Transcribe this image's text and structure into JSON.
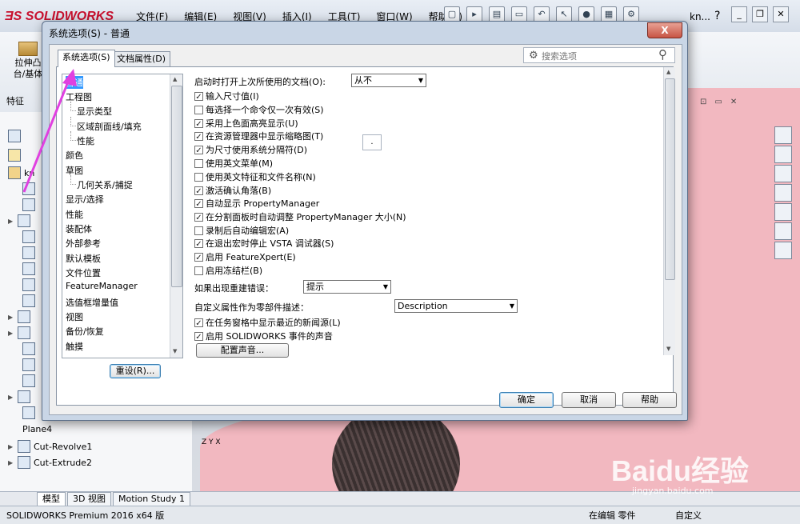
{
  "app": {
    "menu": [
      "文件(F)",
      "编辑(E)",
      "视图(V)",
      "插入(I)",
      "工具(T)",
      "窗口(W)",
      "帮助(H)"
    ],
    "user": "kn...",
    "help": "?",
    "cmd_extrude": "拉伸凸台/基体",
    "cmd_tab": "特征",
    "tree_root": "kn",
    "tree_items": [
      "Plane4",
      "Cut-Revolve1",
      "Cut-Extrude2"
    ],
    "bottom_tabs": [
      "模型",
      "3D 视图",
      "Motion Study 1"
    ],
    "status_left": "SOLIDWORKS Premium 2016 x64 版",
    "status_edit": "在编辑 零件",
    "status_custom": "自定义",
    "watermark": "Baidu经验",
    "watermark_url": "jingyan.baidu.com",
    "triad": "Z Y X",
    "brand_color": "#c8102e",
    "model_color": "#f2b8c0"
  },
  "dialog": {
    "title": "系统选项(S) - 普通",
    "close": "X",
    "tabs": [
      "系统选项(S)",
      "文档属性(D)"
    ],
    "search_placeholder": "搜索选项",
    "categories": [
      {
        "label": "普通",
        "sub": false,
        "selected": true
      },
      {
        "label": "工程图",
        "sub": false
      },
      {
        "label": "显示类型",
        "sub": true
      },
      {
        "label": "区域剖面线/填充",
        "sub": true
      },
      {
        "label": "性能",
        "sub": true
      },
      {
        "label": "颜色",
        "sub": false
      },
      {
        "label": "草图",
        "sub": false
      },
      {
        "label": "几何关系/捕捉",
        "sub": true
      },
      {
        "label": "显示/选择",
        "sub": false
      },
      {
        "label": "性能",
        "sub": false
      },
      {
        "label": "装配体",
        "sub": false
      },
      {
        "label": "外部参考",
        "sub": false
      },
      {
        "label": "默认模板",
        "sub": false
      },
      {
        "label": "文件位置",
        "sub": false
      },
      {
        "label": "FeatureManager",
        "sub": false
      },
      {
        "label": "选值框增量值",
        "sub": false
      },
      {
        "label": "视图",
        "sub": false
      },
      {
        "label": "备份/恢复",
        "sub": false
      },
      {
        "label": "触摸",
        "sub": false
      }
    ],
    "reset": "重设(R)...",
    "startup_label": "启动时打开上次所使用的文档(O):",
    "startup_value": "从不",
    "checkboxes": [
      {
        "label": "输入尺寸值(I)",
        "checked": true
      },
      {
        "label": "每选择一个命令仅一次有效(S)",
        "checked": false
      },
      {
        "label": "采用上色面高亮显示(U)",
        "checked": true
      },
      {
        "label": "在资源管理器中显示缩略图(T)",
        "checked": true
      },
      {
        "label": "为尺寸使用系统分隔符(D)",
        "checked": true
      },
      {
        "label": "使用英文菜单(M)",
        "checked": false
      },
      {
        "label": "使用英文特征和文件名称(N)",
        "checked": false
      },
      {
        "label": "激活确认角落(B)",
        "checked": true
      },
      {
        "label": "自动显示 PropertyManager",
        "checked": true
      },
      {
        "label": "在分割面板时自动调整 PropertyManager 大小(N)",
        "checked": true
      },
      {
        "label": "录制后自动编辑宏(A)",
        "checked": false
      },
      {
        "label": "在退出宏时停止 VSTA 调试器(S)",
        "checked": true
      },
      {
        "label": "启用 FeatureXpert(E)",
        "checked": true
      },
      {
        "label": "启用冻结栏(B)",
        "checked": false
      }
    ],
    "separator_value": ".",
    "rebuild_label": "如果出现重建错误：",
    "rebuild_value": "提示",
    "custom_prop_label": "自定义属性作为零部件描述：",
    "custom_prop_value": "Description",
    "checkboxes2": [
      {
        "label": "在任务窗格中显示最近的新闻源(L)",
        "checked": true
      },
      {
        "label": "启用 SOLIDWORKS 事件的声音",
        "checked": true
      }
    ],
    "config_sound": "配置声音...",
    "ok": "确定",
    "cancel": "取消",
    "help": "帮助",
    "check_mark": "✓",
    "arrow_color": "#e040e0"
  }
}
